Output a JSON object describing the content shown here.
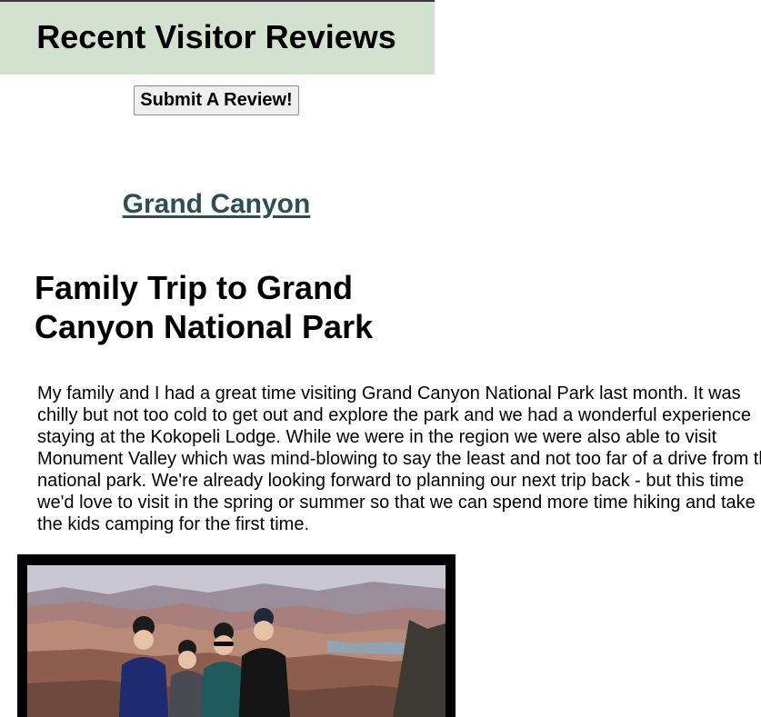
{
  "header": {
    "title": "Recent Visitor Reviews"
  },
  "actions": {
    "submit_label": "Submit A Review!"
  },
  "review": {
    "park_name": "Grand Canyon",
    "title": "Family Trip to Grand Canyon National Park",
    "body": "My family and I had a great time visiting Grand Canyon National Park last month. It was chilly but not too cold to get out and explore the park and we had a wonderful experience staying at the Kokopeli Lodge. While we were in the region we were also able to visit Monument Valley which was mind-blowing to say the least and not too far of a drive from the national park. We're already looking forward to planning our next trip back - but this time we'd love to visit in the spring or summer so that we can spend more time hiking and take the kids camping for the first time."
  },
  "colors": {
    "header_band": "#d3e2cf",
    "park_link": "#2f4f4f",
    "photo_frame": "#000000"
  }
}
